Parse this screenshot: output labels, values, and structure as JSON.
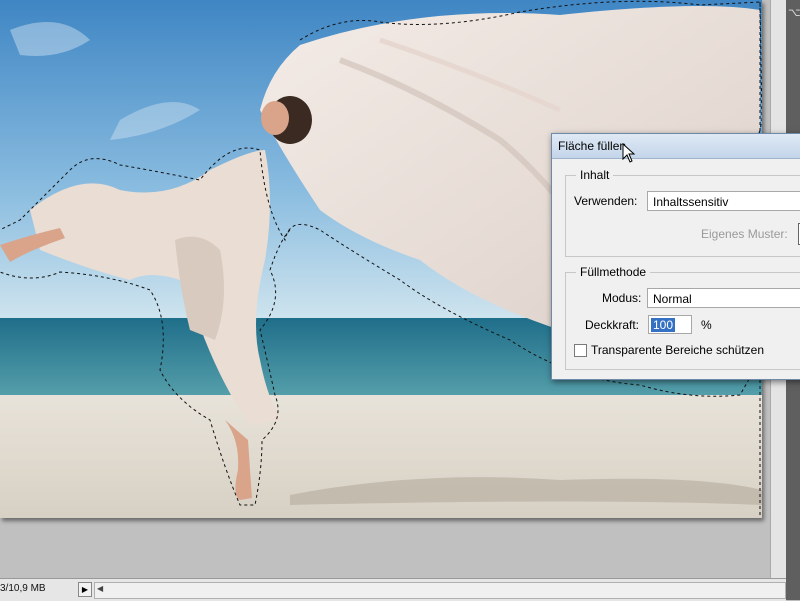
{
  "status_bar": {
    "doc_size": "3/10,9 MB",
    "nav_arrow": "▶",
    "scroll_left_arrow": "◀"
  },
  "canvas": {
    "image_subject": "dancer-with-fabric-on-beach",
    "selection": "marching-ants"
  },
  "dialog": {
    "title": "Fläche füllen",
    "contents_group": {
      "legend": "Inhalt",
      "use_label": "Verwenden:",
      "use_value": "Inhaltssensitiv",
      "custom_pattern_label": "Eigenes Muster:"
    },
    "blending_group": {
      "legend": "Füllmethode",
      "mode_label": "Modus:",
      "mode_value": "Normal",
      "opacity_label": "Deckkraft:",
      "opacity_value": "100",
      "opacity_unit": "%",
      "preserve_transparency_label": "Transparente Bereiche schützen",
      "preserve_transparency_checked": false
    }
  },
  "icons": {
    "panel_tool": "tool-icon",
    "cursor": "mouse-pointer-icon"
  }
}
